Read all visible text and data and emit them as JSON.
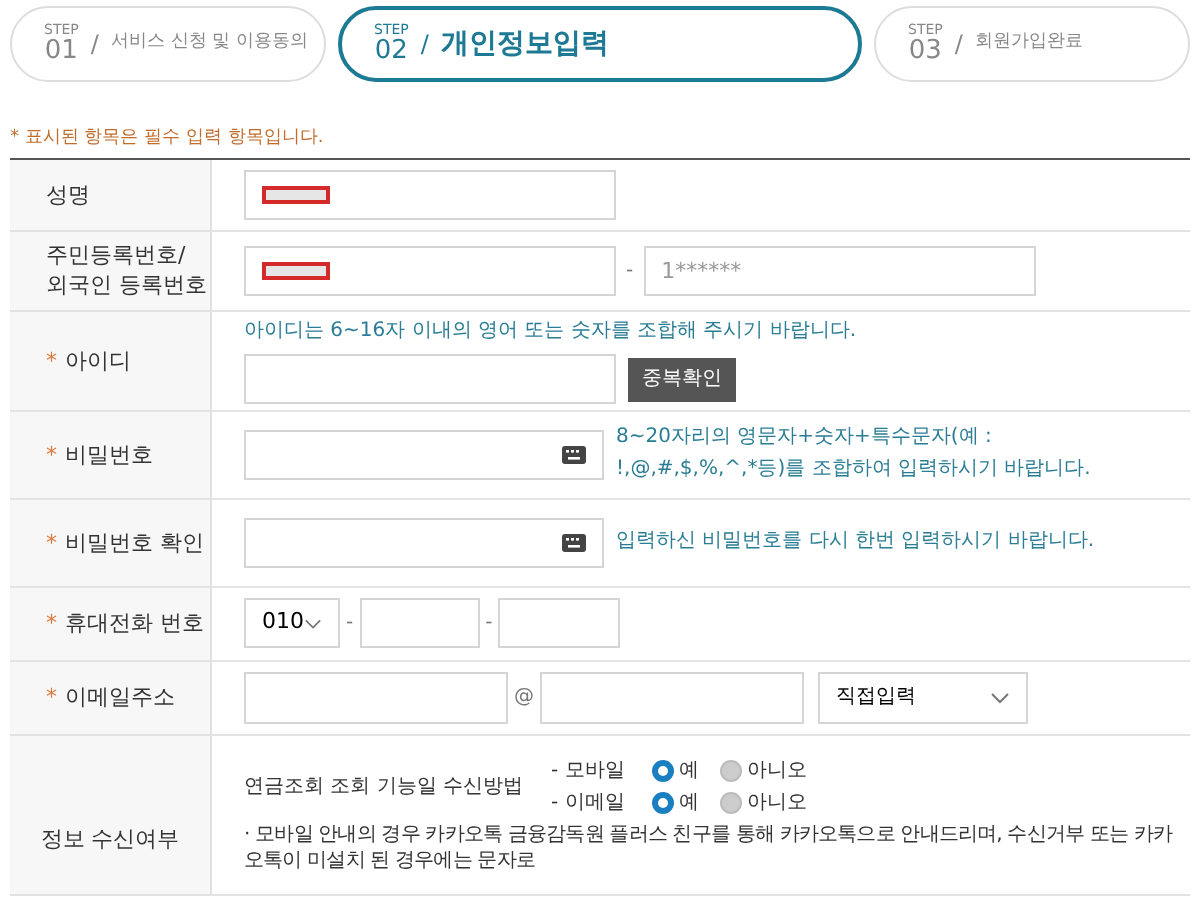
{
  "steps": [
    {
      "label": "STEP",
      "number": "01",
      "slash": "/",
      "title": "서비스 신청 및 이용동의",
      "selected": false
    },
    {
      "label": "STEP",
      "number": "02",
      "slash": "/",
      "title": "개인정보입력",
      "selected": true
    },
    {
      "label": "STEP",
      "number": "03",
      "slash": "/",
      "title": "회원가입완료",
      "selected": false
    }
  ],
  "required_note": {
    "mark": "*",
    "text": "표시된 항목은 필수 입력 항목입니다."
  },
  "rows": [
    {
      "kind": "name",
      "label": "성명",
      "required": false,
      "redacted": true
    },
    {
      "kind": "resident",
      "label": "주민등록번호/\n외국인 등록번호",
      "required": false,
      "redacted": true,
      "separator": "-",
      "placeholder": "1******"
    },
    {
      "kind": "id",
      "label": "아이디",
      "required": true,
      "hint": "아이디는 6~16자 이내의 영어 또는 숫자를 조합해 주시기 바랍니다.",
      "button": "중복확인"
    },
    {
      "kind": "password",
      "label": "비밀번호",
      "required": true,
      "hint": "8~20자리의 영문자+숫자+특수문자(예 : !,@,#,$,%,^,*등)를 조합하여 입력하시기 바랍니다."
    },
    {
      "kind": "password",
      "label": "비밀번호 확인",
      "required": true,
      "hint": "입력하신 비밀번호를 다시 한번 입력하시기 바랍니다."
    },
    {
      "kind": "phone",
      "label": "휴대전화 번호",
      "required": true,
      "prefix": "010",
      "separator": "-"
    },
    {
      "kind": "email",
      "label": "이메일주소",
      "required": true,
      "at": "@",
      "domain_select": "직접입력"
    },
    {
      "kind": "consent",
      "label": "정보 수신여부",
      "required": false,
      "question": "연금조회 조회 기능일 수신방법",
      "options": [
        {
          "channel": "- 모바일",
          "choices": [
            {
              "label": "예",
              "selected": true
            },
            {
              "label": "아니오",
              "selected": false
            }
          ]
        },
        {
          "channel": "- 이메일",
          "choices": [
            {
              "label": "예",
              "selected": true
            },
            {
              "label": "아니오",
              "selected": false
            }
          ]
        }
      ],
      "note": "· 모바일 안내의 경우 카카오톡 금융감독원 플러스 친구를 통해 카카오톡으로 안내드리며, 수신거부 또는 카카오톡이 미설치 된 경우에는 문자로"
    }
  ]
}
